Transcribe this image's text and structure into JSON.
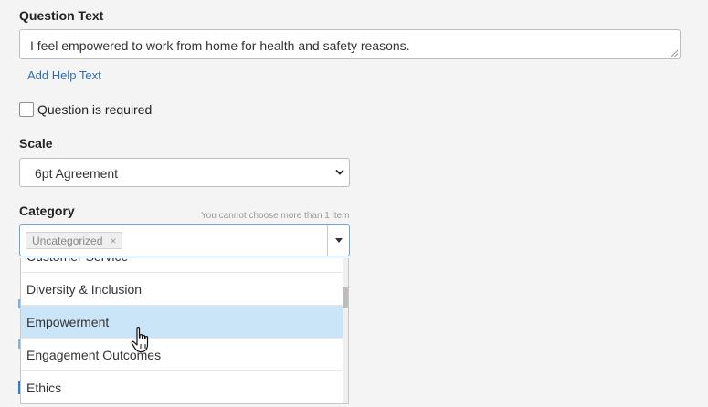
{
  "question_text": {
    "label": "Question Text",
    "value": "I feel empowered to work from home for health and safety reasons.",
    "add_help_label": "Add Help Text"
  },
  "required": {
    "label": "Question is required",
    "checked": false
  },
  "scale": {
    "label": "Scale",
    "selected": "6pt Agreement"
  },
  "category": {
    "label": "Category",
    "hint": "You cannot choose more than 1 item",
    "selected_tag": "Uncategorized",
    "remove_glyph": "×",
    "options": [
      {
        "label": "Customer Service"
      },
      {
        "label": "Diversity & Inclusion"
      },
      {
        "label": "Empowerment",
        "highlighted": true
      },
      {
        "label": "Engagement Outcomes"
      },
      {
        "label": "Ethics"
      }
    ]
  },
  "colors": {
    "link": "#2f6cab",
    "focus_border": "#6aa7d8",
    "highlight": "#cae4f8"
  },
  "icons": [
    "resize-grip-icon",
    "chevron-down-icon",
    "caret-down-icon",
    "hand-pointer-icon"
  ]
}
